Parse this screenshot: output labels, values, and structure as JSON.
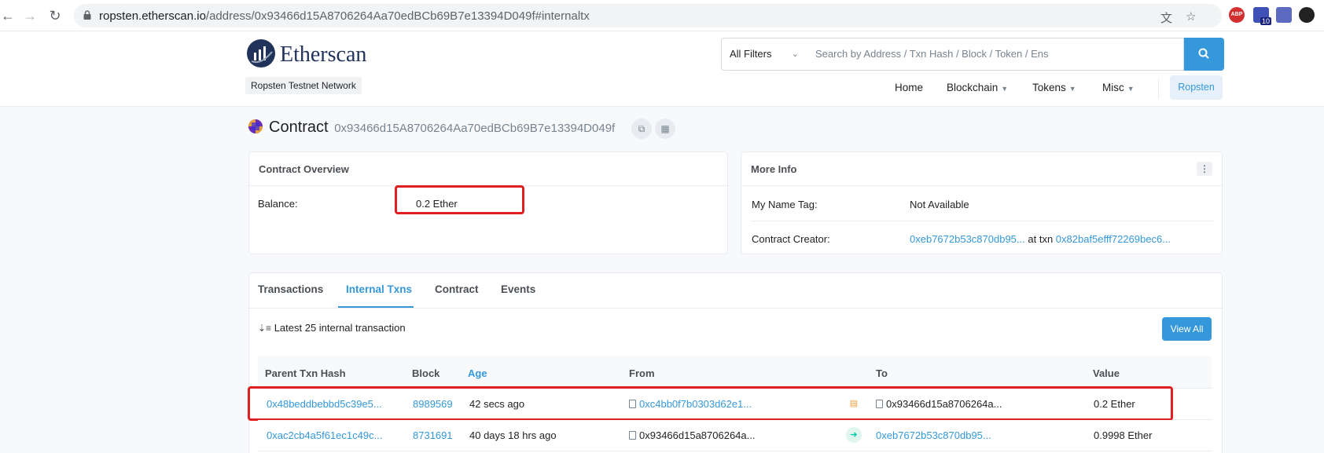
{
  "browser": {
    "url_host": "ropsten.etherscan.io",
    "url_path": "/address/0x93466d15A8706264Aa70edBCb69B7e13394D049f#internaltx",
    "ext_badge": "10"
  },
  "header": {
    "logo_text": "Etherscan",
    "network_badge": "Ropsten Testnet Network",
    "search": {
      "filter_label": "All Filters",
      "placeholder": "Search by Address / Txn Hash / Block / Token / Ens"
    },
    "nav": {
      "home": "Home",
      "blockchain": "Blockchain",
      "tokens": "Tokens",
      "misc": "Misc",
      "network": "Ropsten"
    }
  },
  "page": {
    "title": "Contract",
    "address": "0x93466d15A8706264Aa70edBCb69B7e13394D049f"
  },
  "overview": {
    "header": "Contract Overview",
    "balance_label": "Balance:",
    "balance_value": "0.2 Ether"
  },
  "more_info": {
    "header": "More Info",
    "name_tag_label": "My Name Tag:",
    "name_tag_value": "Not Available",
    "creator_label": "Contract Creator:",
    "creator_address": "0xeb7672b53c870db95...",
    "at_txn": "at txn",
    "creator_txn": "0x82baf5efff72269bec6..."
  },
  "tabs": {
    "transactions": "Transactions",
    "internal": "Internal Txns",
    "contract": "Contract",
    "events": "Events"
  },
  "list": {
    "note": "Latest 25 internal transaction",
    "view_all": "View All"
  },
  "table": {
    "headers": {
      "parent": "Parent Txn Hash",
      "block": "Block",
      "age": "Age",
      "from": "From",
      "to": "To",
      "value": "Value"
    },
    "rows": [
      {
        "parent": "0x48beddbebbd5c39e5...",
        "block": "8989569",
        "age": "42 secs ago",
        "from": "0xc4bb0f7b0303d62e1...",
        "direction_icon": "contract-self-icon",
        "to": "0x93466d15a8706264a...",
        "value": "0.2 Ether"
      },
      {
        "parent": "0xac2cb4a5f61ec1c49c...",
        "block": "8731691",
        "age": "40 days 18 hrs ago",
        "from": "0x93466d15a8706264a...",
        "direction_icon": "arrow-right-icon",
        "to": "0xeb7672b53c870db95...",
        "value": "0.9998 Ether"
      }
    ]
  },
  "colors": {
    "link": "#3498db",
    "highlight": "#e02020",
    "brand": "#21325b"
  }
}
